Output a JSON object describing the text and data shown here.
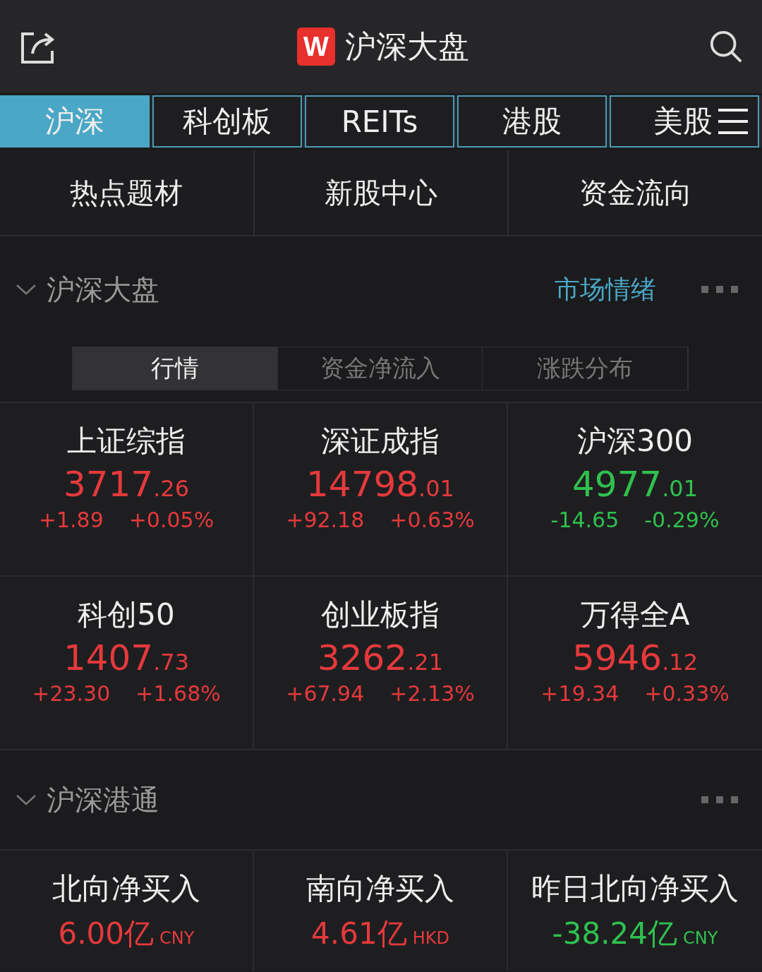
{
  "header": {
    "logo": "W",
    "title": "沪深大盘"
  },
  "tabs": [
    {
      "label": "沪深",
      "selected": true
    },
    {
      "label": "科创板",
      "selected": false
    },
    {
      "label": "REITs",
      "selected": false
    },
    {
      "label": "港股",
      "selected": false
    },
    {
      "label": "美股",
      "selected": false
    }
  ],
  "shortcuts": [
    "热点题材",
    "新股中心",
    "资金流向"
  ],
  "market_section": {
    "title": "沪深大盘",
    "expanded": true,
    "link": "市场情绪",
    "segments": [
      {
        "label": "行情",
        "selected": true
      },
      {
        "label": "资金净流入",
        "selected": false
      },
      {
        "label": "涨跌分布",
        "selected": false
      }
    ],
    "indices": [
      {
        "name": "上证综指",
        "value_int": "3717",
        "value_dec": ".26",
        "change": "+1.89",
        "pct": "+0.05%",
        "color": "#e5393c"
      },
      {
        "name": "深证成指",
        "value_int": "14798",
        "value_dec": ".01",
        "change": "+92.18",
        "pct": "+0.63%",
        "color": "#e5393c"
      },
      {
        "name": "沪深300",
        "value_int": "4977",
        "value_dec": ".01",
        "change": "-14.65",
        "pct": "-0.29%",
        "color": "#2fc14f"
      },
      {
        "name": "科创50",
        "value_int": "1407",
        "value_dec": ".73",
        "change": "+23.30",
        "pct": "+1.68%",
        "color": "#e5393c"
      },
      {
        "name": "创业板指",
        "value_int": "3262",
        "value_dec": ".21",
        "change": "+67.94",
        "pct": "+2.13%",
        "color": "#e5393c"
      },
      {
        "name": "万得全A",
        "value_int": "5946",
        "value_dec": ".12",
        "change": "+19.34",
        "pct": "+0.33%",
        "color": "#e5393c"
      }
    ]
  },
  "connect_section": {
    "title": "沪深港通",
    "expanded": true,
    "flows": [
      {
        "name": "北向净买入",
        "amount": "6.00亿",
        "currency": "CNY",
        "color": "#e5393c"
      },
      {
        "name": "南向净买入",
        "amount": "4.61亿",
        "currency": "HKD",
        "color": "#e5393c"
      },
      {
        "name": "昨日北向净买入",
        "amount": "-38.24亿",
        "currency": "CNY",
        "color": "#2fc14f"
      }
    ]
  }
}
